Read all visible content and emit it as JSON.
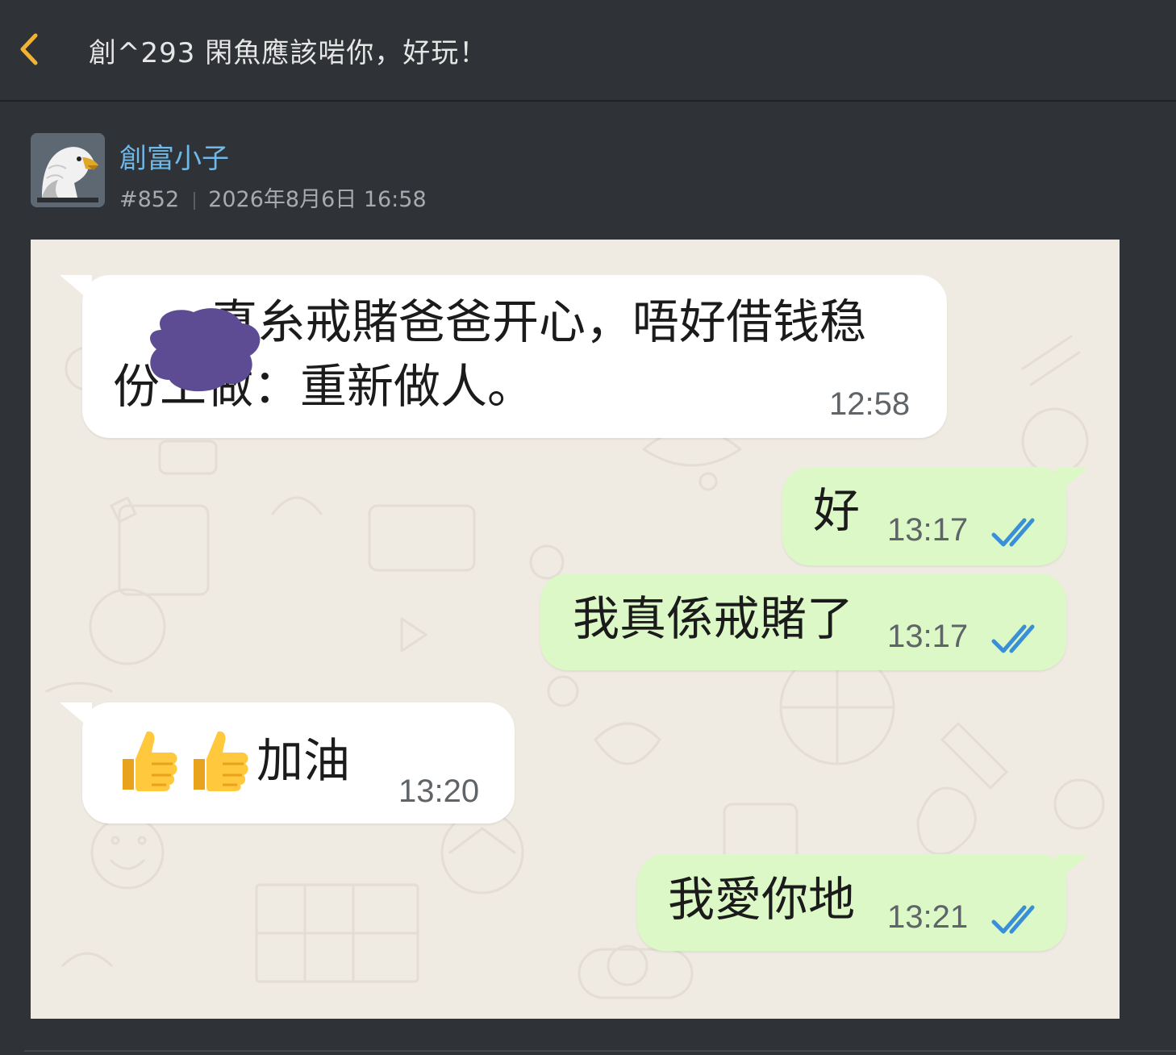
{
  "header": {
    "thread_title": "創^293 閑魚應該啱你，好玩！"
  },
  "post": {
    "author": "創富小子",
    "post_number": "#852",
    "timestamp": "2026年8月6日 16:58"
  },
  "chat": {
    "messages": [
      {
        "direction": "in",
        "line1": "真糸戒賭爸爸开心，唔好借钱稳",
        "line2": "份工做：重新做人。",
        "time": "12:58"
      },
      {
        "direction": "out",
        "text": "好",
        "time": "13:17",
        "status": "read"
      },
      {
        "direction": "out",
        "text": "我真係戒賭了",
        "time": "13:17",
        "status": "read"
      },
      {
        "direction": "in",
        "text": "加油",
        "emoji": "👍👍",
        "time": "13:20"
      },
      {
        "direction": "out",
        "text": "我愛你地",
        "time": "13:21",
        "status": "read"
      }
    ]
  },
  "colors": {
    "accent": "#f2b233",
    "author_link": "#6fb8e8",
    "incoming_bubble": "#ffffff",
    "outgoing_bubble": "#dbf8c6",
    "read_ticks": "#3a8fd6",
    "chat_background": "#efeae2"
  },
  "icons": {
    "back": "chevron-left-icon",
    "avatar": "eagle-avatar",
    "read_receipt": "double-check-icon"
  }
}
